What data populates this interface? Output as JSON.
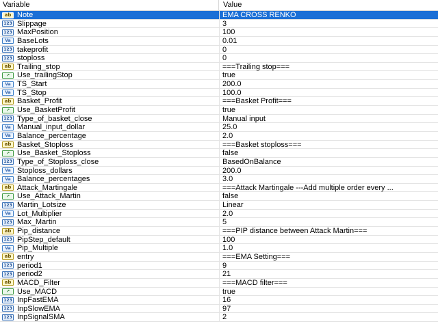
{
  "header": {
    "variable": "Variable",
    "value": "Value"
  },
  "rows": [
    {
      "icon": "ab",
      "name": "Note",
      "value": "EMA CROSS RENKO"
    },
    {
      "icon": "123",
      "name": "Slippage",
      "value": "3"
    },
    {
      "icon": "123",
      "name": "MaxPosition",
      "value": "100"
    },
    {
      "icon": "Va",
      "name": "BaseLots",
      "value": "0.01"
    },
    {
      "icon": "123",
      "name": "takeprofit",
      "value": "0"
    },
    {
      "icon": "123",
      "name": "stoploss",
      "value": "0"
    },
    {
      "icon": "ab",
      "name": "Trailing_stop",
      "value": "===Trailing stop==="
    },
    {
      "icon": "trend",
      "name": "Use_trailingStop",
      "value": "true"
    },
    {
      "icon": "Va",
      "name": "TS_Start",
      "value": "200.0"
    },
    {
      "icon": "Va",
      "name": "TS_Stop",
      "value": "100.0"
    },
    {
      "icon": "ab",
      "name": "Basket_Profit",
      "value": "===Basket Profit==="
    },
    {
      "icon": "trend",
      "name": "Use_BasketProfit",
      "value": "true"
    },
    {
      "icon": "123",
      "name": "Type_of_basket_close",
      "value": "Manual input"
    },
    {
      "icon": "Va",
      "name": "Manual_input_dollar",
      "value": "25.0"
    },
    {
      "icon": "Va",
      "name": "Balance_percentage",
      "value": "2.0"
    },
    {
      "icon": "ab",
      "name": "Basket_Stoploss",
      "value": "===Basket stoploss==="
    },
    {
      "icon": "trend",
      "name": "Use_Basket_Stoploss",
      "value": "false"
    },
    {
      "icon": "123",
      "name": "Type_of_Stoploss_close",
      "value": "BasedOnBalance"
    },
    {
      "icon": "Va",
      "name": "Stoploss_dollars",
      "value": "200.0"
    },
    {
      "icon": "Va",
      "name": "Balance_percentages",
      "value": "3.0"
    },
    {
      "icon": "ab",
      "name": "Attack_Martingale",
      "value": "===Attack Martingale ---Add multiple order every ..."
    },
    {
      "icon": "trend",
      "name": "Use_Attack_Martin",
      "value": "false"
    },
    {
      "icon": "123",
      "name": "Martin_Lotsize",
      "value": "Linear"
    },
    {
      "icon": "Va",
      "name": "Lot_Multiplier",
      "value": "2.0"
    },
    {
      "icon": "123",
      "name": "Max_Martin",
      "value": "5"
    },
    {
      "icon": "ab",
      "name": "Pip_distance",
      "value": "===PIP distance between Attack Martin==="
    },
    {
      "icon": "123",
      "name": "PipStep_default",
      "value": "100"
    },
    {
      "icon": "Va",
      "name": "Pip_Multiple",
      "value": "1.0"
    },
    {
      "icon": "ab",
      "name": "entry",
      "value": "===EMA Setting==="
    },
    {
      "icon": "123",
      "name": "period1",
      "value": "9"
    },
    {
      "icon": "123",
      "name": "period2",
      "value": "21"
    },
    {
      "icon": "ab",
      "name": "MACD_Filter",
      "value": "===MACD filter==="
    },
    {
      "icon": "trend",
      "name": "Use_MACD",
      "value": "true"
    },
    {
      "icon": "123",
      "name": "InpFastEMA",
      "value": "16"
    },
    {
      "icon": "123",
      "name": "InpSlowEMA",
      "value": "97"
    },
    {
      "icon": "123",
      "name": "InpSignalSMA",
      "value": "2"
    }
  ],
  "selected_row": 0,
  "colors": {
    "selection": "#1b6fd6",
    "grid_line": "#e4e4e4"
  }
}
